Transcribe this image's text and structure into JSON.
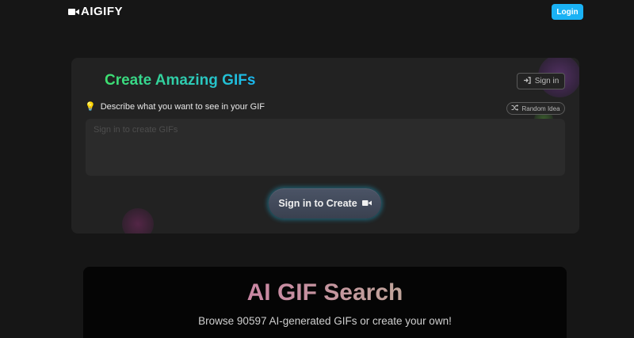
{
  "nav": {
    "brand": "AIGIFY",
    "brand_icon": "video-camera-icon",
    "login_label": "Login",
    "login_color": "#1ab2f5"
  },
  "create_card": {
    "title": "Create Amazing GIFs",
    "signin_label": "Sign in",
    "signin_icon": "sign-in-icon",
    "prompt_label": "Describe what you want to see in your GIF",
    "prompt_icon": "lightbulb-icon",
    "random_label": "Random Idea",
    "random_icon": "shuffle-icon",
    "prompt_value": "",
    "prompt_placeholder": "Sign in to create GIFs",
    "create_label": "Sign in to Create",
    "create_icon": "video-camera-icon"
  },
  "search": {
    "title": "AI GIF Search",
    "subtitle": "Browse 90597 AI-generated GIFs or create your own!"
  },
  "colors": {
    "background": "#161616",
    "card": "#222222",
    "title_gradient_start": "#3ee06f",
    "title_gradient_end": "#1ab8f0"
  }
}
